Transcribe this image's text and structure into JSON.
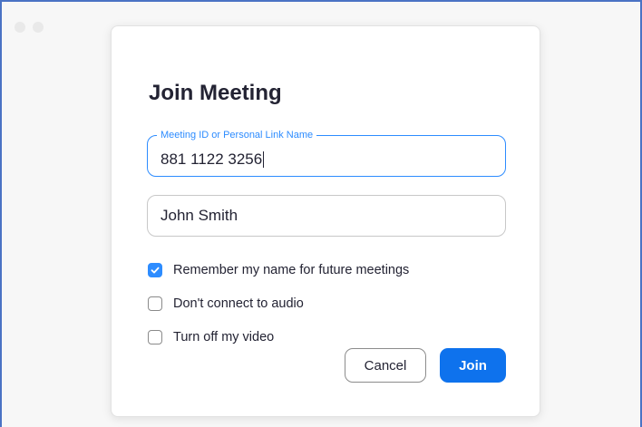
{
  "window": {
    "traffic_lights": [
      "close",
      "minimize",
      "maximize"
    ]
  },
  "dialog": {
    "title": "Join Meeting",
    "meeting_id": {
      "label": "Meeting ID or Personal Link Name",
      "value": "881 1122 3256"
    },
    "name": {
      "value": "John Smith"
    },
    "options": [
      {
        "label": "Remember my name for future meetings",
        "checked": true
      },
      {
        "label": "Don't connect to audio",
        "checked": false
      },
      {
        "label": "Turn off my video",
        "checked": false
      }
    ],
    "buttons": {
      "cancel_label": "Cancel",
      "join_label": "Join"
    }
  },
  "colors": {
    "accent": "#2d8cff",
    "join_button": "#0e72ed",
    "window_border": "#4a73c4"
  }
}
